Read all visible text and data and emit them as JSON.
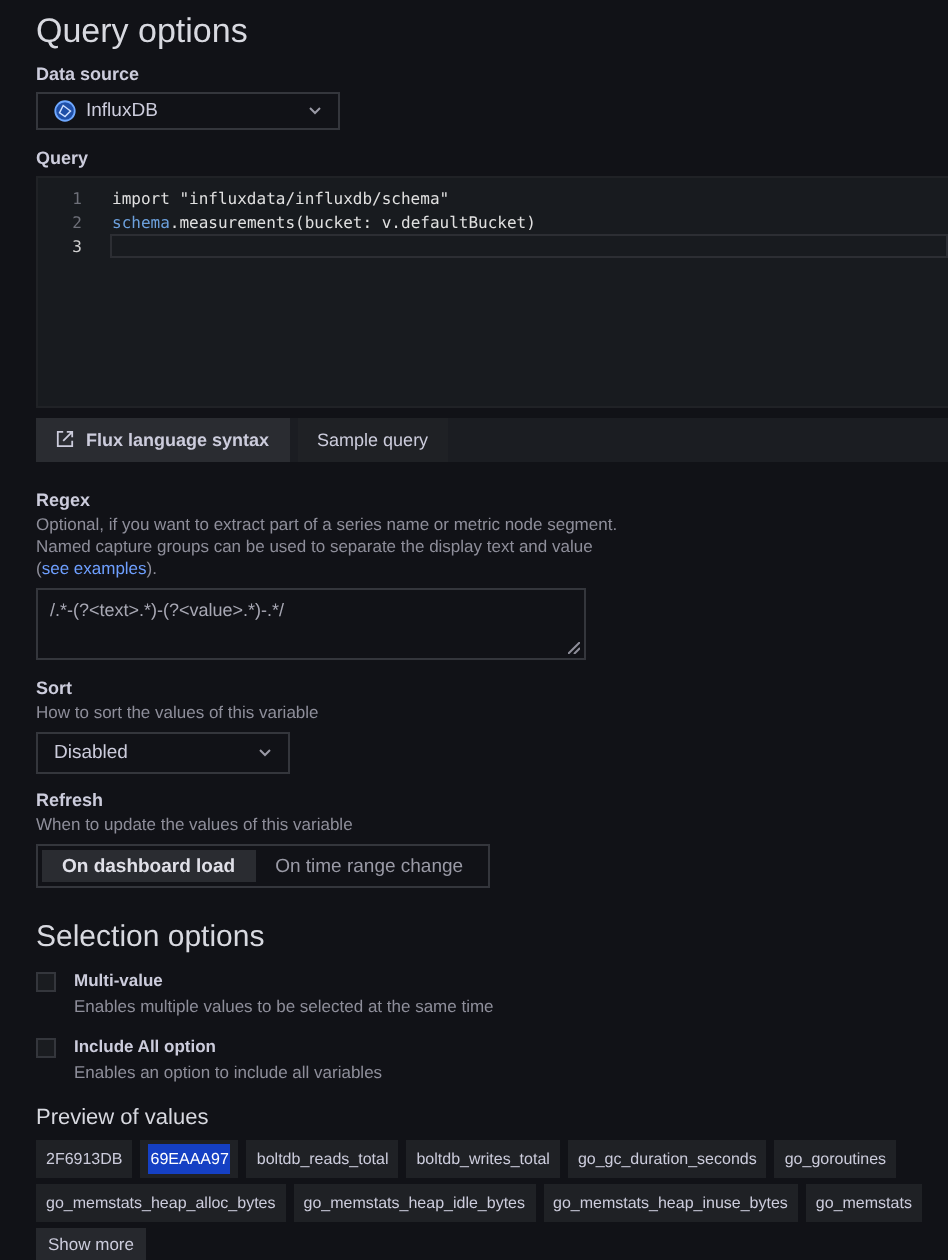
{
  "title": "Query options",
  "data_source": {
    "label": "Data source",
    "value": "InfluxDB"
  },
  "query": {
    "label": "Query",
    "lines": [
      {
        "number": "1",
        "tokens": [
          {
            "text": "import \"influxdata/influxdb/schema\"",
            "kind": "plain"
          }
        ],
        "current": false
      },
      {
        "number": "2",
        "tokens": [
          {
            "text": "schema",
            "kind": "ident"
          },
          {
            "text": ".measurements(bucket: v.defaultBucket)",
            "kind": "plain"
          }
        ],
        "current": false
      },
      {
        "number": "3",
        "current": true
      }
    ]
  },
  "query_tabs": [
    {
      "label": "Flux language syntax",
      "kind": "link",
      "selected": true
    },
    {
      "label": "Sample query",
      "kind": "plain",
      "selected": false
    }
  ],
  "regex": {
    "label": "Regex",
    "help": "Optional, if you want to extract part of a series name or metric node segment. Named capture groups can be used to separate the display text and value (",
    "link": "see examples",
    "help_end": ").",
    "value": "/.*-(?<text>.*)-(?<value>.*)-.*/"
  },
  "sort": {
    "label": "Sort",
    "help": "How to sort the values of this variable",
    "value": "Disabled"
  },
  "refresh": {
    "label": "Refresh",
    "help": "When to update the values of this variable",
    "options": [
      {
        "label": "On dashboard load",
        "selected": true
      },
      {
        "label": "On time range change",
        "selected": false
      }
    ]
  },
  "selection": {
    "title": "Selection options",
    "options": [
      {
        "label": "Multi-value",
        "description": "Enables multiple values to be selected at the same time",
        "checked": false
      },
      {
        "label": "Include All option",
        "description": "Enables an option to include all variables",
        "checked": false
      }
    ]
  },
  "preview": {
    "title": "Preview of values",
    "lines": [
      {
        "chips": [
          {
            "text": "2F6913DB",
            "highlighted": false
          },
          {
            "text": "69EAAA97",
            "highlighted": true
          },
          {
            "text": "boltdb_reads_total",
            "highlighted": false
          },
          {
            "text": "boltdb_writes_total",
            "highlighted": false
          },
          {
            "text": "go_gc_duration_seconds",
            "highlighted": false
          },
          {
            "text": "go_goroutines",
            "highlighted": false
          }
        ]
      },
      {
        "chips": [
          {
            "text": "go_memstats_heap_alloc_bytes",
            "highlighted": false
          },
          {
            "text": "go_memstats_heap_idle_bytes",
            "highlighted": false
          },
          {
            "text": "go_memstats_heap_inuse_bytes",
            "highlighted": false
          },
          {
            "text": "go_memstats",
            "highlighted": false
          }
        ]
      }
    ],
    "show_more": "Show more"
  }
}
